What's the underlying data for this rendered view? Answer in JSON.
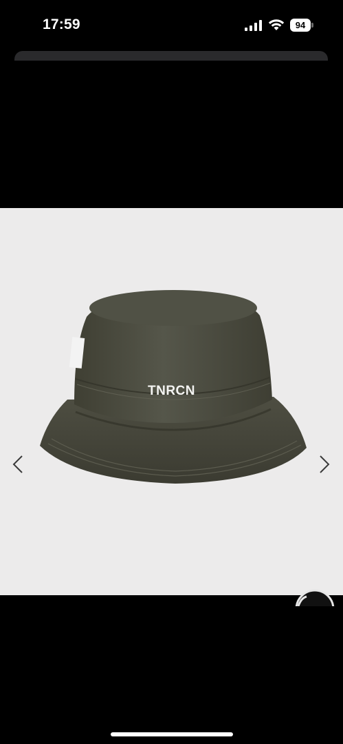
{
  "status_bar": {
    "time": "17:59",
    "battery_level": "94",
    "signal_icon": "cellular-signal-icon",
    "wifi_icon": "wifi-icon"
  },
  "product_image": {
    "brand_text": "TNRCN",
    "hat_color": "#4a4a3c",
    "background_color": "#ecebeb"
  },
  "navigation": {
    "prev_icon": "chevron-left-icon",
    "next_icon": "chevron-right-icon"
  }
}
